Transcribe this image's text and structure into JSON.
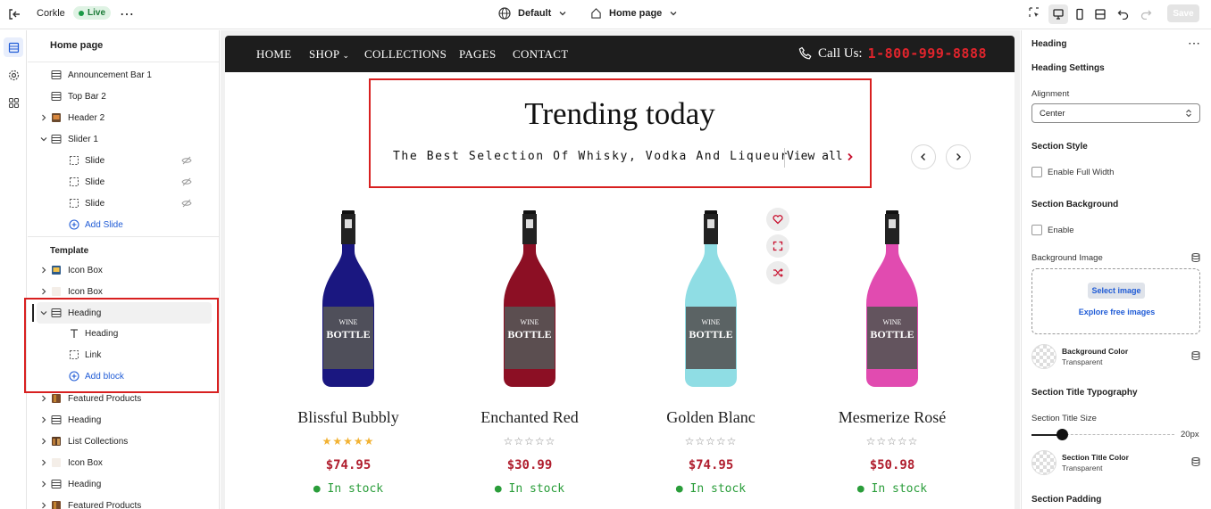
{
  "topbar": {
    "store_name": "Corkle",
    "live_label": "Live",
    "theme_label": "Default",
    "page_label": "Home page",
    "save_label": "Save"
  },
  "sidebar": {
    "title": "Home page",
    "header_items": [
      {
        "label": "Announcement Bar 1",
        "icon": "section-icon"
      },
      {
        "label": "Top Bar 2",
        "icon": "section-icon"
      },
      {
        "label": "Header 2",
        "icon": "image-icon"
      },
      {
        "label": "Slider 1",
        "icon": "section-icon"
      }
    ],
    "slides": [
      "Slide",
      "Slide",
      "Slide"
    ],
    "add_slide": "Add Slide",
    "template_title": "Template",
    "template_items": [
      {
        "label": "Icon Box"
      },
      {
        "label": "Icon Box"
      },
      {
        "label": "Heading"
      },
      {
        "label": "Heading"
      },
      {
        "label": "Link"
      },
      {
        "label": "Add block"
      },
      {
        "label": "Featured Products"
      },
      {
        "label": "Heading"
      },
      {
        "label": "List Collections"
      },
      {
        "label": "Icon Box"
      },
      {
        "label": "Heading"
      },
      {
        "label": "Featured Products"
      }
    ]
  },
  "store": {
    "nav": [
      "HOME",
      "SHOP",
      "COLLECTIONS",
      "PAGES",
      "CONTACT"
    ],
    "call_label": "Call Us:",
    "phone": "1-800-999-8888",
    "heading": "Trending today",
    "subtitle": "The Best Selection Of Whisky, Vodka And Liqueur",
    "view_all": "View all",
    "products": [
      {
        "name": "Blissful Bubbly",
        "price": "$74.95",
        "stock": "In stock",
        "rating": 5,
        "bottle_color": "#1a1780"
      },
      {
        "name": "Enchanted Red",
        "price": "$30.99",
        "stock": "In stock",
        "rating": 0,
        "bottle_color": "#8c0f24"
      },
      {
        "name": "Golden Blanc",
        "price": "$74.95",
        "stock": "In stock",
        "rating": 0,
        "bottle_color": "#8fdde4"
      },
      {
        "name": "Mesmerize Rosé",
        "price": "$50.98",
        "stock": "In stock",
        "rating": 0,
        "bottle_color": "#e14bb0"
      }
    ]
  },
  "rpanel": {
    "title": "Heading",
    "settings_title": "Heading Settings",
    "alignment_label": "Alignment",
    "alignment_value": "Center",
    "section_style": "Section Style",
    "full_width": "Enable Full Width",
    "section_background": "Section Background",
    "enable": "Enable",
    "bg_image": "Background Image",
    "select_image": "Select image",
    "explore": "Explore free images",
    "bg_color_label": "Background Color",
    "bg_color_value": "Transparent",
    "typography_title": "Section Title Typography",
    "title_size_label": "Section Title Size",
    "title_size_value": "20px",
    "title_color_label": "Section Title Color",
    "title_color_value": "Transparent",
    "padding_title": "Section Padding"
  },
  "colors": {
    "accent": "#1f5bd6",
    "highlight": "#d82020",
    "price": "#b01e2e",
    "stock": "#2a9d3a",
    "phone": "#e0242c"
  }
}
